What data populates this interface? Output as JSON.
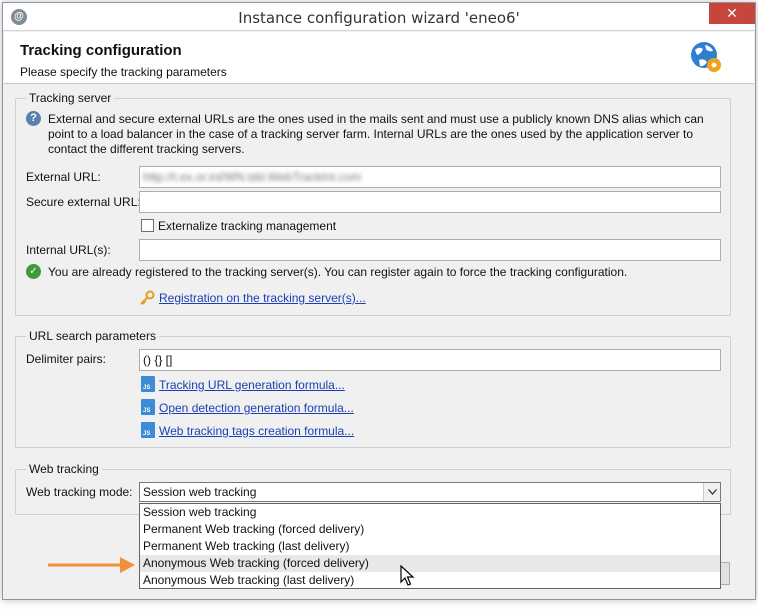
{
  "window": {
    "title": "Instance configuration wizard 'eneo6'",
    "close_glyph": "✕",
    "app_icon_glyph": "@"
  },
  "header": {
    "title": "Tracking configuration",
    "subtitle": "Please specify the tracking parameters"
  },
  "tracking_server": {
    "legend": "Tracking server",
    "description_lines": [
      "External and secure external URLs are the ones used in the mails sent and must use a publicly known DNS alias which can",
      "point to a load balancer in the case of a tracking server farm. Internal URLs are the ones used by the application server to",
      "contact the different tracking servers."
    ],
    "external_url_label": "External URL:",
    "external_url_value": "http://t.ex.or.ini/WN.tdd.WebTrackInt.com",
    "secure_external_url_label": "Secure external URL:",
    "secure_external_url_value": "",
    "externalize_label": "Externalize tracking management",
    "externalize_checked": false,
    "internal_urls_label": "Internal URL(s):",
    "internal_urls_value": "",
    "registered_message": "You are already registered to the tracking server(s). You can register again to force the tracking configuration.",
    "registration_link": "Registration on the tracking server(s)..."
  },
  "url_search": {
    "legend": "URL search parameters",
    "delimiter_label": "Delimiter pairs:",
    "delimiter_value": "() {} []",
    "links": [
      "Tracking URL generation formula...",
      "Open detection generation formula...",
      "Web tracking tags creation formula..."
    ]
  },
  "web_tracking": {
    "legend": "Web tracking",
    "mode_label": "Web tracking mode:",
    "mode_selected": "Session web tracking",
    "options": [
      "Session web tracking",
      "Permanent Web tracking (forced delivery)",
      "Permanent Web tracking (last delivery)",
      "Anonymous Web tracking (forced delivery)",
      "Anonymous Web tracking (last delivery)"
    ],
    "hovered_index": 3
  },
  "colors": {
    "link": "#1a3fb4",
    "arrow": "#f0913a",
    "close": "#c7463b"
  }
}
